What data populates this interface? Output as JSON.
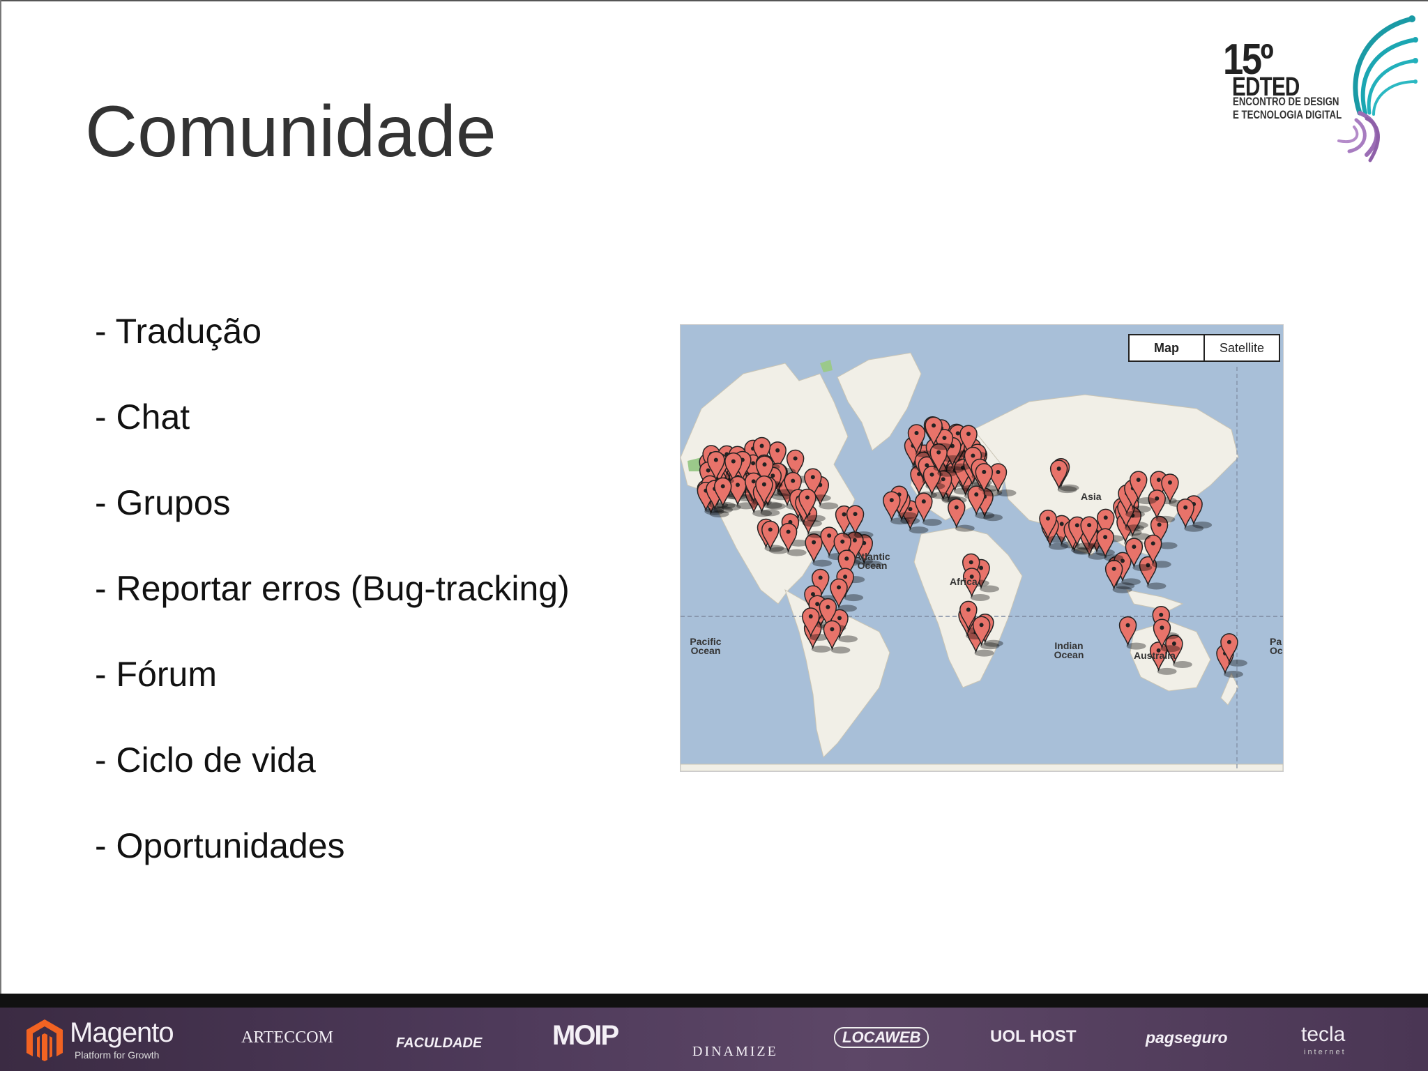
{
  "slide": {
    "title": "Comunidade",
    "bullets": [
      "- Tradução",
      "- Chat",
      "- Grupos",
      "- Reportar erros (Bug-tracking)",
      "- Fórum",
      "- Ciclo de vida",
      "- Oportunidades"
    ]
  },
  "event_logo": {
    "number": "15º",
    "name": "EDTED",
    "subtitle_line1": "ENCONTRO DE DESIGN",
    "subtitle_line2": "E TECNOLOGIA DIGITAL"
  },
  "map": {
    "buttons": {
      "map": "Map",
      "satellite": "Satellite"
    },
    "active_view": "Map",
    "labels": {
      "asia": "Asia",
      "atlantic": "Atlantic Ocean",
      "africa": "Africa",
      "pacific_left": "Pacific Ocean",
      "indian": "Indian Ocean",
      "australia": "Australia",
      "pacific_right": "Pa Oc"
    },
    "colors": {
      "water": "#a8bfd8",
      "land": "#f1efe7",
      "marker": "#e8736a"
    }
  },
  "sponsors": {
    "magento": "Magento",
    "magento_tagline": "Platform for Growth",
    "arteccom": "ARTECCOM",
    "faculdade": "FACULDADE",
    "moip": "MOIP",
    "dinamize": "DINAMIZE",
    "locaweb": "LOCAWEB",
    "uolhost": "UOL HOST",
    "pagseguro": "pagseguro",
    "tecla": "tecla",
    "tecla_sub": "internet"
  },
  "colors": {
    "footer_purple": "#4e3a5a",
    "title_gray": "#333333"
  }
}
